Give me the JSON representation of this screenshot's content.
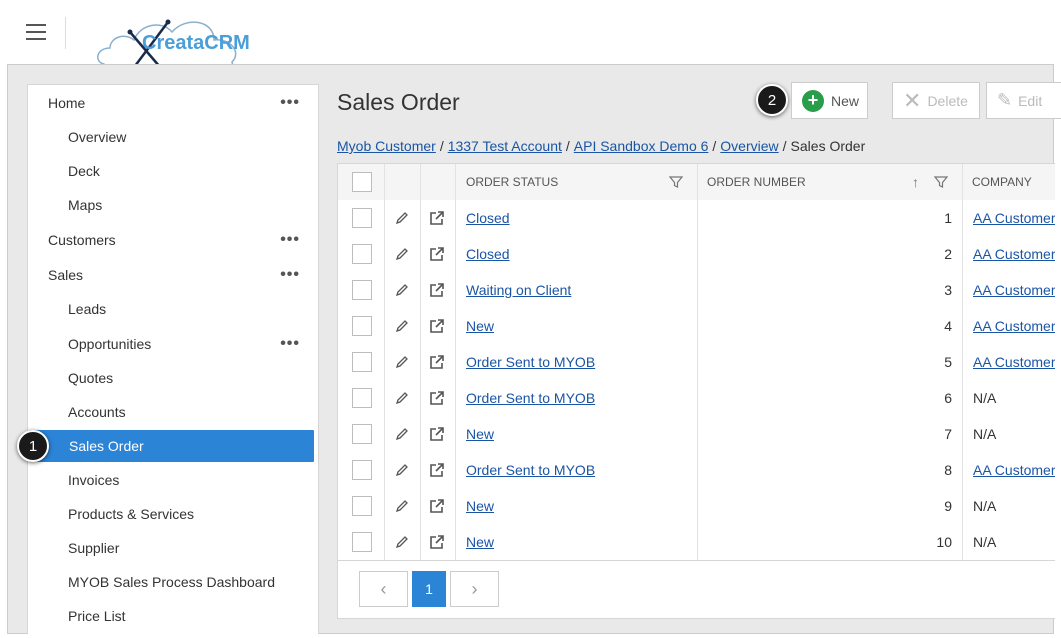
{
  "app": {
    "logo_text": "CreataCRM"
  },
  "sidebar": {
    "items": [
      {
        "label": "Home",
        "level": 0,
        "dots": true
      },
      {
        "label": "Overview",
        "level": 1,
        "dots": false
      },
      {
        "label": "Deck",
        "level": 1,
        "dots": false
      },
      {
        "label": "Maps",
        "level": 1,
        "dots": false
      },
      {
        "label": "Customers",
        "level": 0,
        "dots": true
      },
      {
        "label": "Sales",
        "level": 0,
        "dots": true
      },
      {
        "label": "Leads",
        "level": 1,
        "dots": false
      },
      {
        "label": "Opportunities",
        "level": 1,
        "dots": true
      },
      {
        "label": "Quotes",
        "level": 1,
        "dots": false
      },
      {
        "label": "Accounts",
        "level": 1,
        "dots": false
      },
      {
        "label": "Sales Order",
        "level": 1,
        "dots": false,
        "active": true
      },
      {
        "label": "Invoices",
        "level": 1,
        "dots": false
      },
      {
        "label": "Products & Services",
        "level": 1,
        "dots": false
      },
      {
        "label": "Supplier",
        "level": 1,
        "dots": false
      },
      {
        "label": "MYOB Sales Process Dashboard",
        "level": 1,
        "dots": false
      },
      {
        "label": "Price List",
        "level": 1,
        "dots": false
      }
    ],
    "dots_glyph": "•••"
  },
  "callouts": {
    "one": "1",
    "two": "2"
  },
  "main": {
    "title": "Sales Order",
    "toolbar": {
      "new_label": "New",
      "delete_label": "Delete",
      "edit_label": "Edit"
    },
    "breadcrumb": [
      {
        "label": "Myob Customer",
        "link": true
      },
      {
        "label": "1337 Test Account",
        "link": true
      },
      {
        "label": "API Sandbox Demo 6",
        "link": true
      },
      {
        "label": "Overview",
        "link": true
      },
      {
        "label": "Sales Order",
        "link": false
      }
    ],
    "breadcrumb_sep": "/"
  },
  "table": {
    "columns": {
      "status": "ORDER STATUS",
      "number": "ORDER NUMBER",
      "company": "COMPANY"
    },
    "rows": [
      {
        "status": "Closed",
        "number": "1",
        "company": "AA Customer",
        "company_link": true
      },
      {
        "status": "Closed",
        "number": "2",
        "company": "AA Customer",
        "company_link": true
      },
      {
        "status": "Waiting on Client",
        "number": "3",
        "company": "AA Customer",
        "company_link": true
      },
      {
        "status": "New",
        "number": "4",
        "company": "AA Customer",
        "company_link": true
      },
      {
        "status": "Order Sent to MYOB",
        "number": "5",
        "company": "AA Customer",
        "company_link": true
      },
      {
        "status": "Order Sent to MYOB",
        "number": "6",
        "company": "N/A",
        "company_link": false
      },
      {
        "status": "New",
        "number": "7",
        "company": "N/A",
        "company_link": false
      },
      {
        "status": "Order Sent to MYOB",
        "number": "8",
        "company": "AA Customer",
        "company_link": true
      },
      {
        "status": "New",
        "number": "9",
        "company": "N/A",
        "company_link": false
      },
      {
        "status": "New",
        "number": "10",
        "company": "N/A",
        "company_link": false
      }
    ]
  },
  "pager": {
    "prev": "‹",
    "current": "1",
    "next": "›"
  },
  "icons": {
    "edit_row": "pencil-icon",
    "open_row": "external-link-icon",
    "filter": "filter-icon",
    "sort": "sort-asc-icon"
  }
}
